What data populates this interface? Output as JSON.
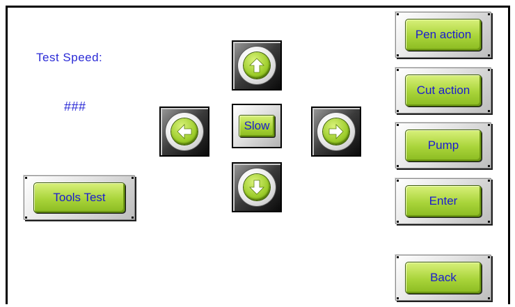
{
  "labels": {
    "test_speed": "Test Speed:",
    "speed_value": "###"
  },
  "buttons": {
    "tools_test": "Tools Test",
    "slow": "Slow",
    "pen_action": "Pen action",
    "cut_action": "Cut action",
    "pump": "Pump",
    "enter": "Enter",
    "back": "Back"
  },
  "icons": {
    "up": "arrow-up-icon",
    "down": "arrow-down-icon",
    "left": "arrow-left-icon",
    "right": "arrow-right-icon"
  },
  "colors": {
    "label_text": "#2a2ad6",
    "button_text": "#1b1bd0",
    "button_face": "#a9d43a"
  }
}
